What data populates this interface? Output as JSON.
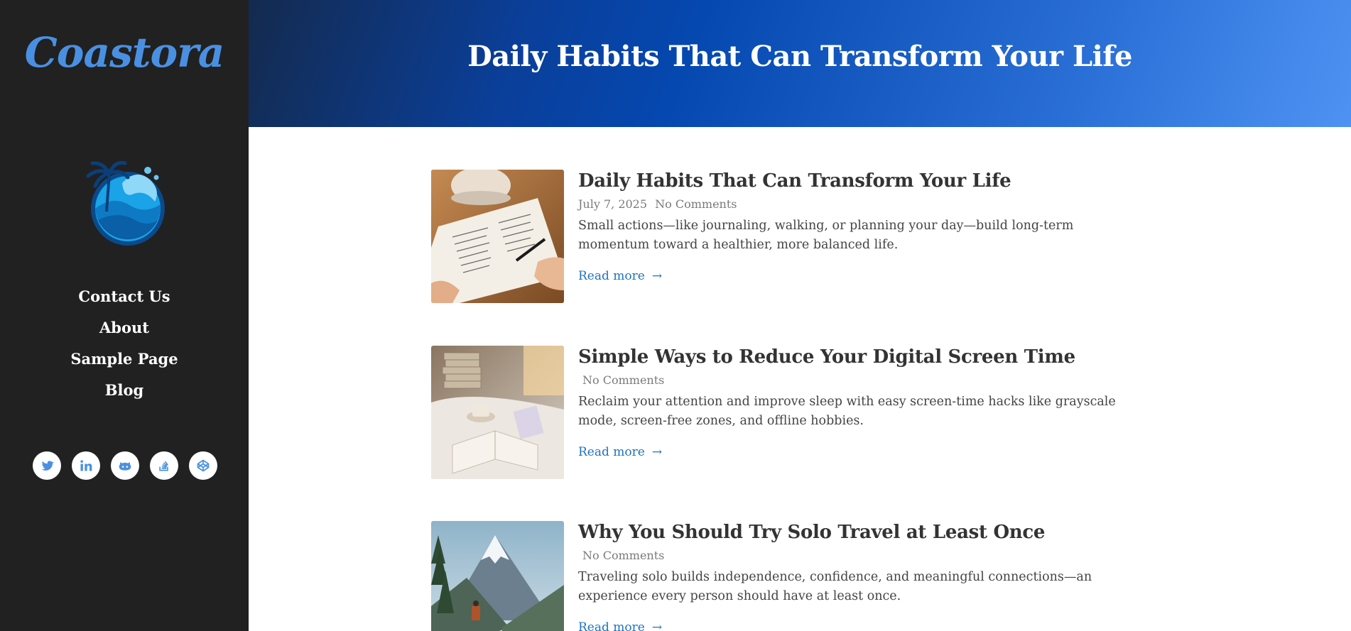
{
  "site": {
    "logo_text": "Coastora"
  },
  "nav": {
    "items": [
      {
        "label": "Contact Us"
      },
      {
        "label": "About"
      },
      {
        "label": "Sample Page"
      },
      {
        "label": "Blog"
      }
    ]
  },
  "socials": [
    {
      "icon": "twitter-icon"
    },
    {
      "icon": "linkedin-icon"
    },
    {
      "icon": "github-icon"
    },
    {
      "icon": "stackoverflow-icon"
    },
    {
      "icon": "codepen-icon"
    }
  ],
  "hero": {
    "title": "Daily Habits That Can Transform Your Life"
  },
  "posts": [
    {
      "title": "Daily Habits That Can Transform Your Life",
      "date": "July 7, 2025",
      "comments": "No Comments",
      "excerpt": "Small actions—like journaling, walking, or planning your day—build long-term momentum toward a healthier, more balanced life.",
      "read_more": "Read more",
      "arrow": "→"
    },
    {
      "title": "Simple Ways to Reduce Your Digital Screen Time",
      "date": "",
      "comments": "No Comments",
      "excerpt": "Reclaim your attention and improve sleep with easy screen-time hacks like grayscale mode, screen-free zones, and offline hobbies.",
      "read_more": "Read more",
      "arrow": "→"
    },
    {
      "title": "Why You Should Try Solo Travel at Least Once",
      "date": "",
      "comments": "No Comments",
      "excerpt": "Traveling solo builds independence, confidence, and meaningful connections—an experience every person should have at least once.",
      "read_more": "Read more",
      "arrow": "→"
    }
  ],
  "colors": {
    "sidebar_bg": "#212121",
    "accent": "#4a90e2",
    "link": "#1e73be"
  }
}
